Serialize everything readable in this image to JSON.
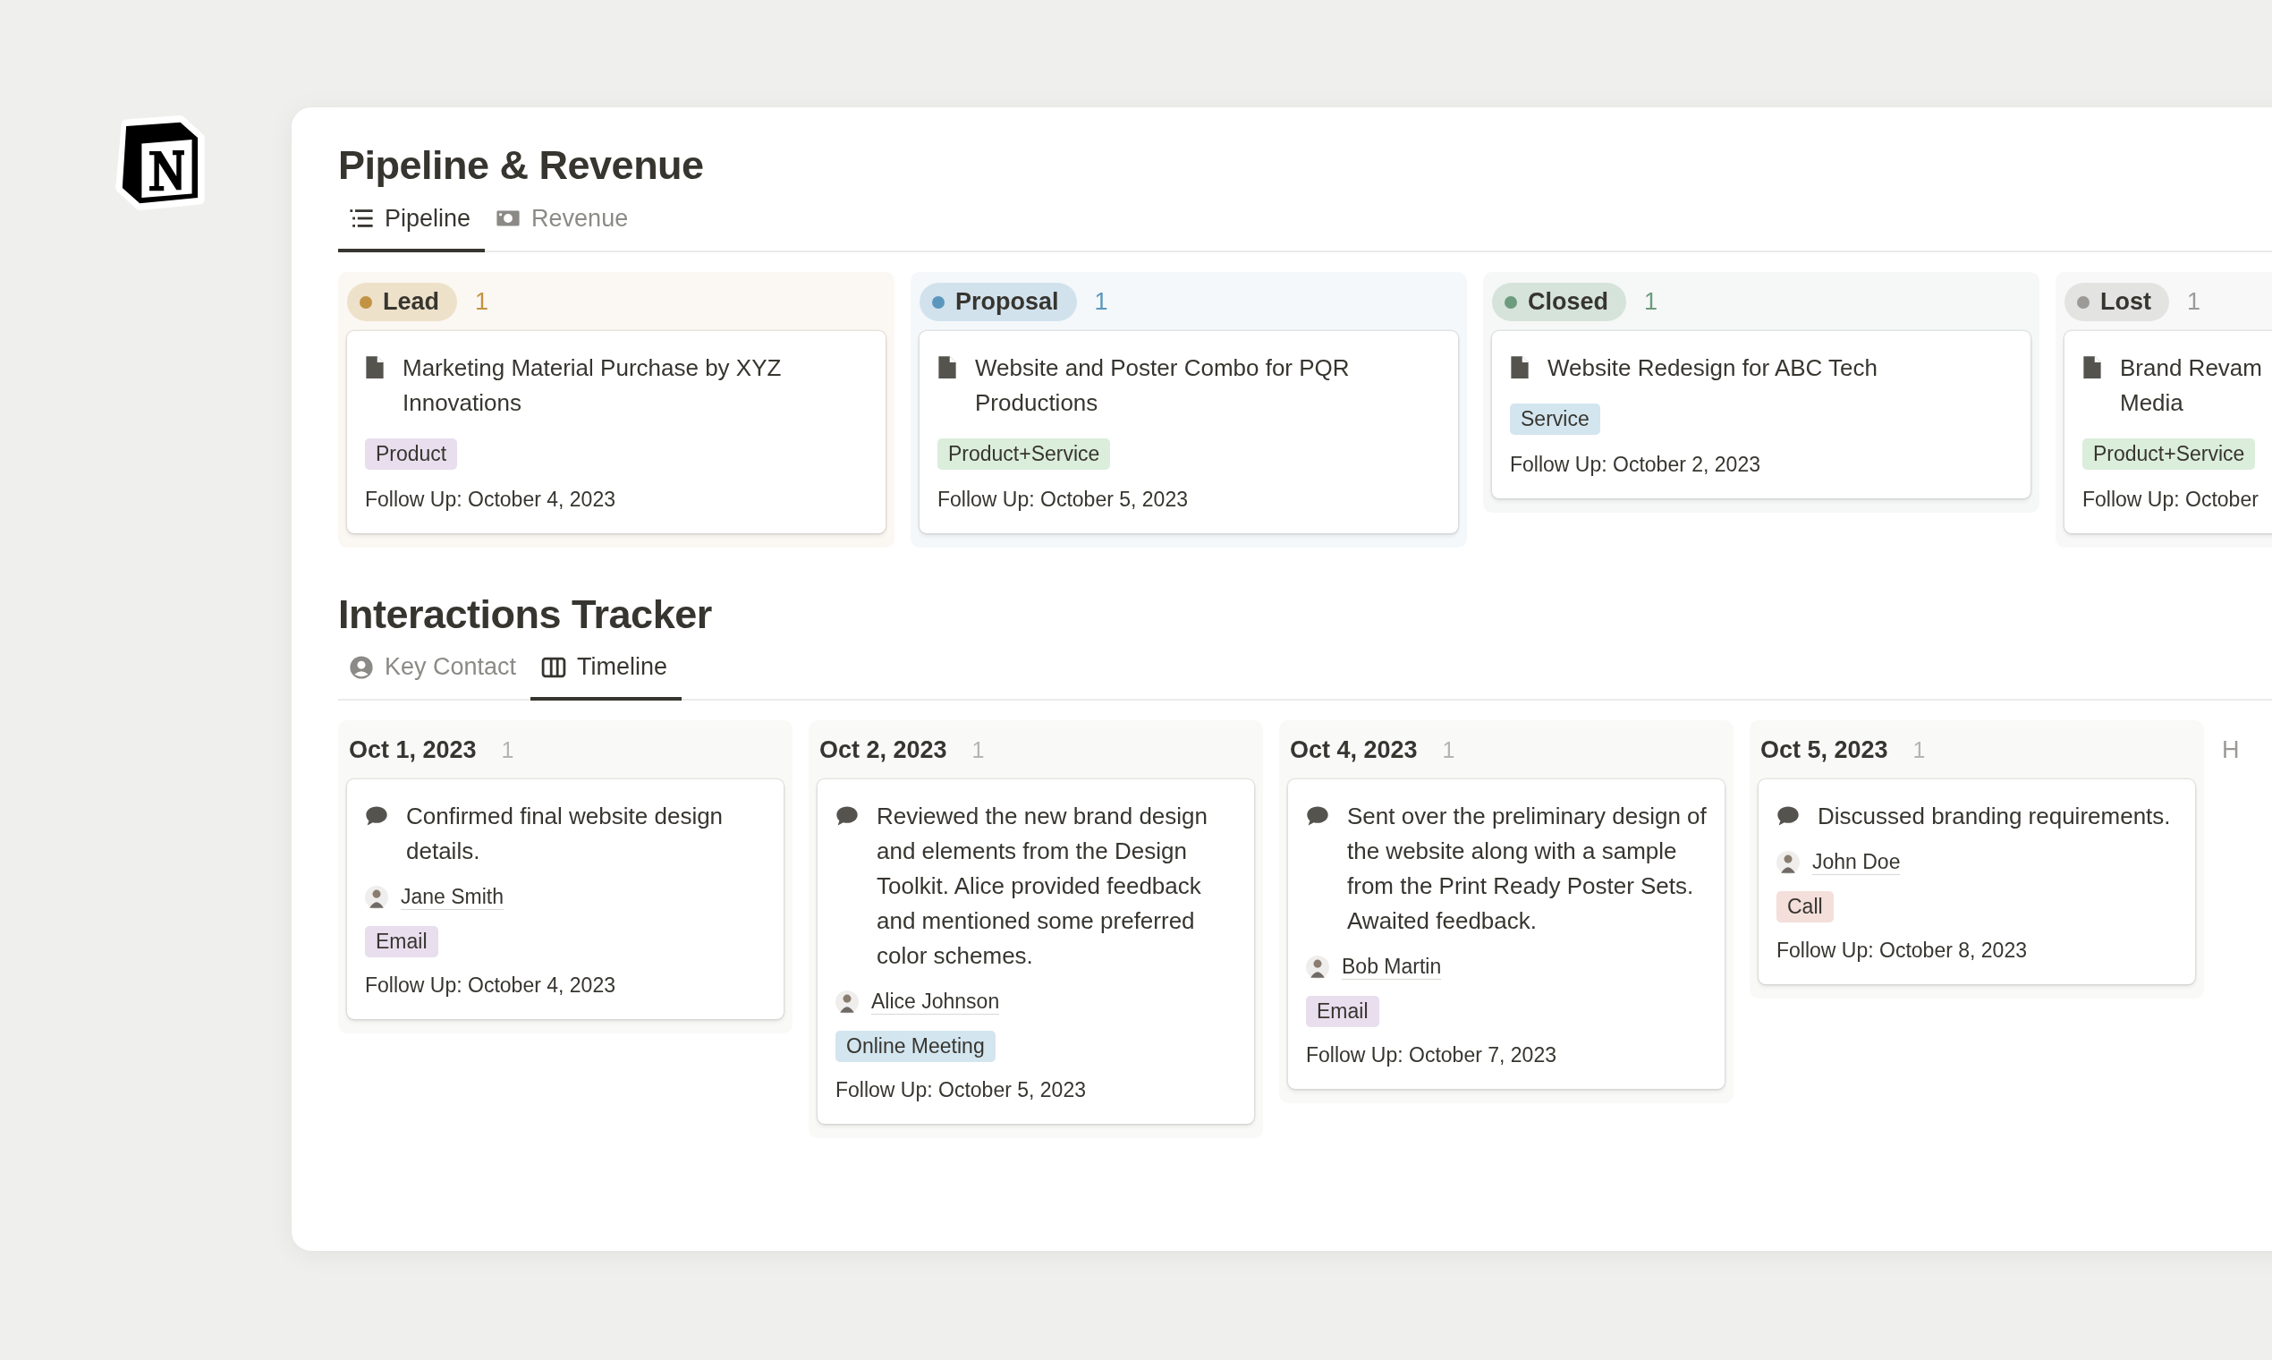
{
  "pipeline": {
    "title": "Pipeline & Revenue",
    "tabs": [
      {
        "label": "Pipeline",
        "selected": true
      },
      {
        "label": "Revenue",
        "selected": false
      }
    ],
    "columns": [
      {
        "status": "Lead",
        "count": "1",
        "color": "#c29343",
        "cards": [
          {
            "title": "Marketing Material Purchase by XYZ Innovations",
            "tag": {
              "label": "Product",
              "color": "#e8deee"
            },
            "follow_up": "Follow Up: October 4, 2023"
          }
        ]
      },
      {
        "status": "Proposal",
        "count": "1",
        "color": "#5b97bd",
        "cards": [
          {
            "title": "Website and Poster Combo for PQR Productions",
            "tag": {
              "label": "Product+Service",
              "color": "#dbeddb"
            },
            "follow_up": "Follow Up: October 5, 2023"
          }
        ]
      },
      {
        "status": "Closed",
        "count": "1",
        "color": "#6c9b7d",
        "cards": [
          {
            "title": "Website Redesign for ABC Tech",
            "tag": {
              "label": "Service",
              "color": "#d3e5ef"
            },
            "follow_up": "Follow Up: October 2, 2023"
          }
        ]
      },
      {
        "status": "Lost",
        "count": "1",
        "color": "#9b9a97",
        "cards": [
          {
            "title": "Brand Revam\nMedia",
            "tag": {
              "label": "Product+Service",
              "color": "#dbeddb"
            },
            "follow_up": "Follow Up: October"
          }
        ]
      }
    ]
  },
  "interactions": {
    "title": "Interactions Tracker",
    "tabs": [
      {
        "label": "Key Contact",
        "selected": false
      },
      {
        "label": "Timeline",
        "selected": true
      }
    ],
    "columns": [
      {
        "date": "Oct 1, 2023",
        "count": "1",
        "cards": [
          {
            "note": "Confirmed final website design details.",
            "contact": "Jane Smith",
            "tag": {
              "label": "Email",
              "color": "#e8deee"
            },
            "follow_up": "Follow Up: October 4, 2023"
          }
        ]
      },
      {
        "date": "Oct 2, 2023",
        "count": "1",
        "cards": [
          {
            "note": "Reviewed the new brand design and elements from the Design Toolkit. Alice provided feedback and mentioned some preferred color schemes.",
            "contact": "Alice Johnson",
            "tag": {
              "label": "Online Meeting",
              "color": "#d3e5ef"
            },
            "follow_up": "Follow Up: October 5, 2023"
          }
        ]
      },
      {
        "date": "Oct 4, 2023",
        "count": "1",
        "cards": [
          {
            "note": "Sent over the preliminary design of the website along with a sample from the Print Ready Poster Sets. Awaited feedback.",
            "contact": "Bob Martin",
            "tag": {
              "label": "Email",
              "color": "#e8deee"
            },
            "follow_up": "Follow Up: October 7, 2023"
          }
        ]
      },
      {
        "date": "Oct 5, 2023",
        "count": "1",
        "cards": [
          {
            "note": "Discussed branding requirements.",
            "contact": "John Doe",
            "tag": {
              "label": "Call",
              "color": "#f4dfdb"
            },
            "follow_up": "Follow Up: October 8, 2023"
          }
        ]
      },
      {
        "date": "H"
      }
    ]
  }
}
